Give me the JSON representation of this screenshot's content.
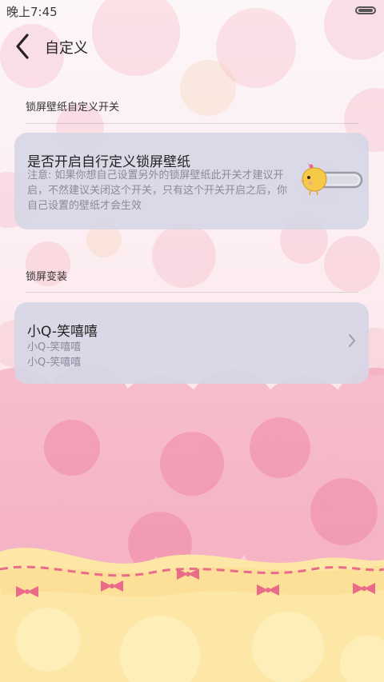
{
  "status_bar": {
    "time": "晚上7:45",
    "battery_icon": "battery-icon"
  },
  "header": {
    "back_icon": "chevron-left-icon",
    "title": "自定义"
  },
  "sections": [
    {
      "label": "锁屏壁纸自定义开关",
      "setting": {
        "title": "是否开启自行定义锁屏壁纸",
        "description": "注意: 如果你想自己设置另外的锁屏壁纸此开关才建议开启，不然建议关闭这个开关，只有这个开关开启之后，你自己设置的壁纸才会生效",
        "toggle_state": "off",
        "toggle_icon": "chick-toggle-icon"
      }
    },
    {
      "label": "锁屏变装",
      "item": {
        "title": "小Q-笑嘻嘻",
        "subtitle_1": "小Q-笑嘻嘻",
        "subtitle_2": "小Q-笑嘻嘻",
        "arrow_icon": "chevron-right-icon"
      }
    }
  ],
  "colors": {
    "card_background": "#d6d6e6",
    "bokeh_pink": "#f28aa6",
    "banner_yellow": "#fde7a6",
    "bow_pink": "#e86c8a"
  }
}
